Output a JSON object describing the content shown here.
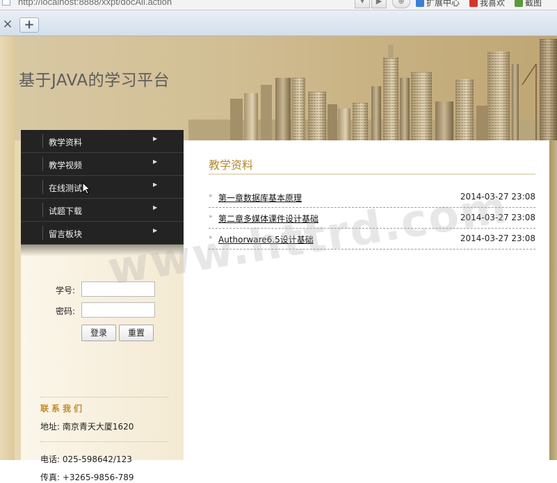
{
  "browser": {
    "url": "http://localhost:8888/xxpt/docAll.action",
    "toolbar_items": [
      "扩展中心",
      "我喜欢",
      "截图"
    ],
    "tab_close": "×",
    "tab_new": "+"
  },
  "site": {
    "title": "基于JAVA的学习平台"
  },
  "menu": {
    "items": [
      {
        "label": "教学资料"
      },
      {
        "label": "教学视频"
      },
      {
        "label": "在线测试"
      },
      {
        "label": "试题下载"
      },
      {
        "label": "留言板块"
      }
    ],
    "arrow": "▶"
  },
  "login": {
    "id_label": "学号:",
    "password_label": "密码:",
    "id_value": "",
    "password_value": "",
    "login_button": "登录",
    "reset_button": "重置"
  },
  "contact": {
    "title": "联系我们",
    "address": "地址: 南京青天大厦1620",
    "phone": "电话: 025-598642/123",
    "fax": "传真: +3265-9856-789"
  },
  "main": {
    "title": "教学资料",
    "bullet": "»",
    "docs": [
      {
        "title": "第一章数据库基本原理",
        "date": "2014-03-27 23:08"
      },
      {
        "title": "第二章多媒体课件设计基础",
        "date": "2014-03-27 23:08"
      },
      {
        "title": "Authorware6.5设计基础",
        "date": "2014-03-27 23:08"
      }
    ]
  },
  "watermark": "www.httrd.com",
  "colors": {
    "menu_bg": "#232323",
    "accent_title": "#b28a2e",
    "contact_title": "#c18a2b",
    "page_bg": "#e7d8b4"
  }
}
